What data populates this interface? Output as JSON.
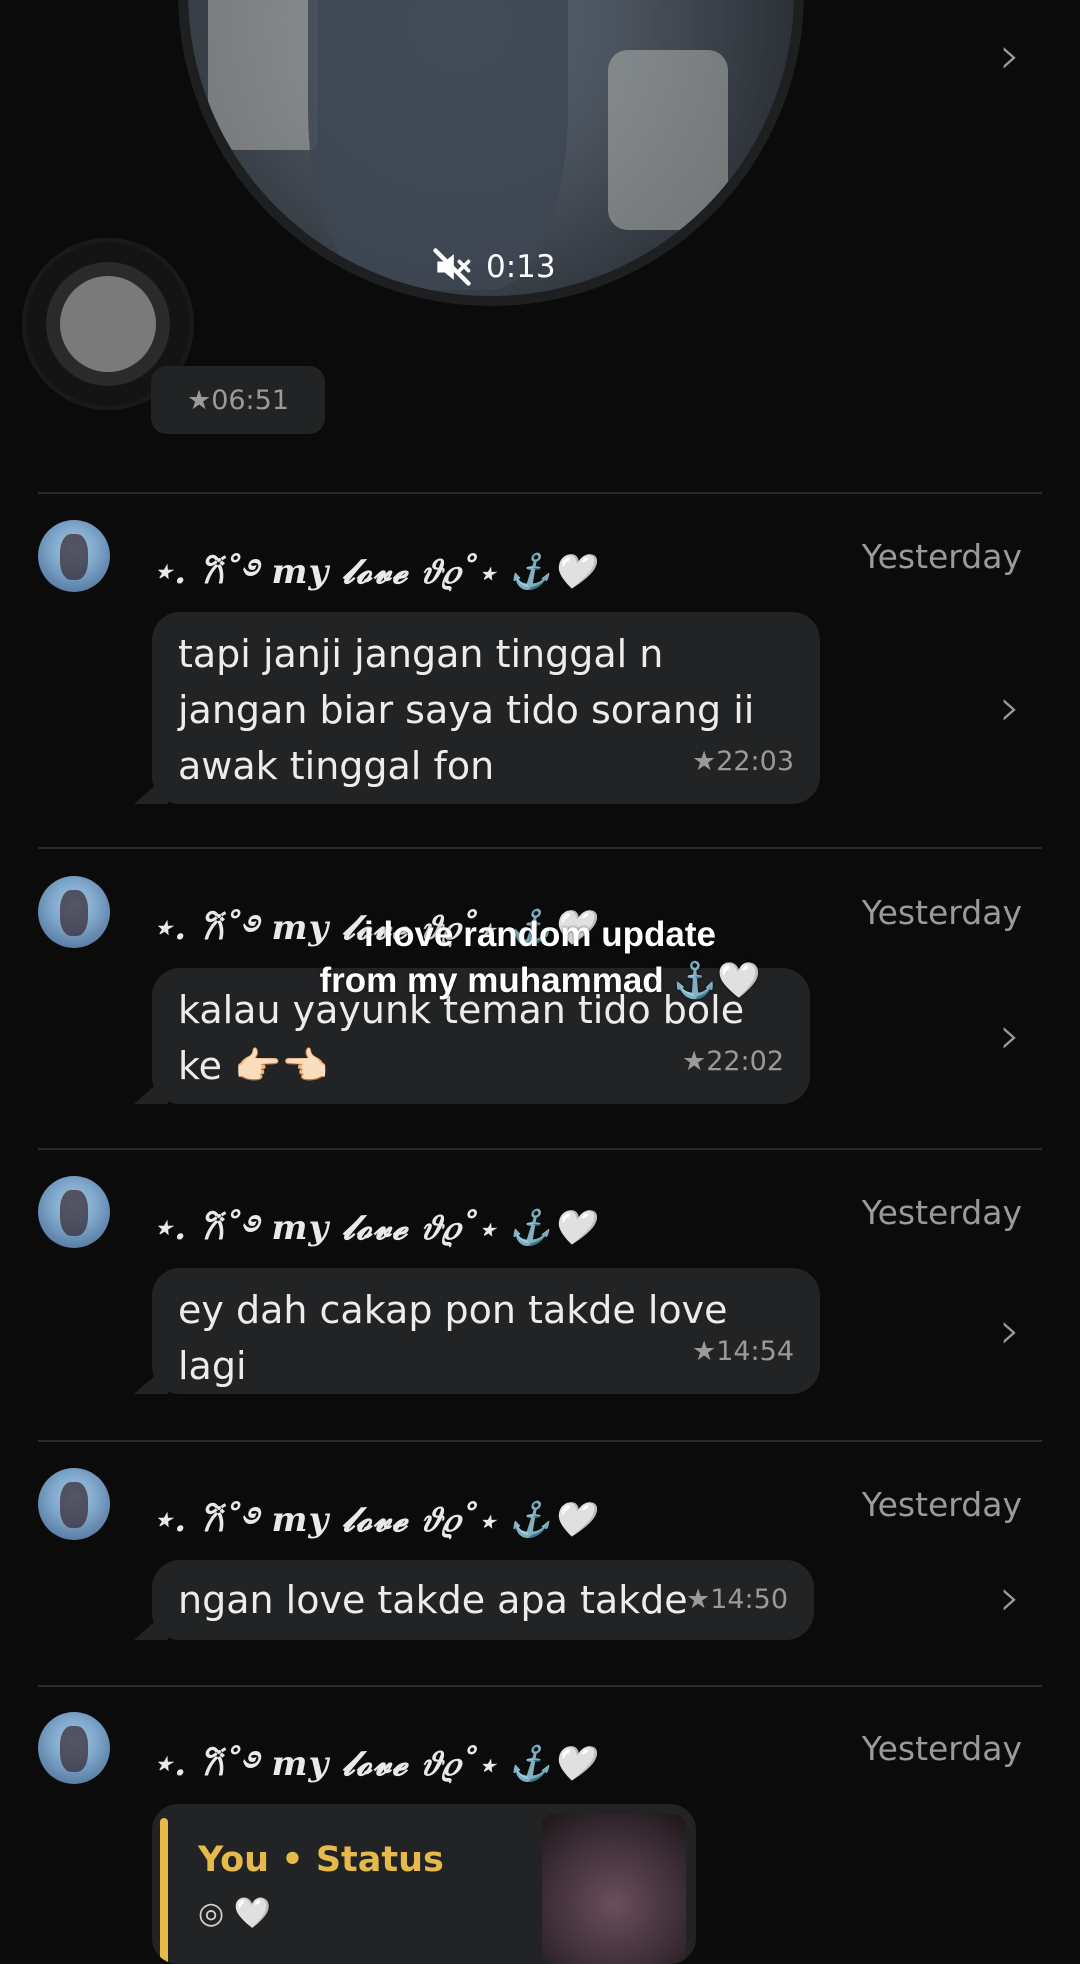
{
  "video_note": {
    "duration": "0:13",
    "icon": "mute-icon"
  },
  "record_button": {
    "icon": "record-icon"
  },
  "first_time": "★06:51",
  "overlay_caption": {
    "line1": "i love random update",
    "line2": "from my muhammad ⚓🤍"
  },
  "messages": [
    {
      "sender": "⋆. 𐙚˚࿔ 𝒎𝒚 𝓵𝓸𝓿𝓮 𝜗𝜚˚⋆ ⚓🤍",
      "date": "Yesterday",
      "text": "tapi janji jangan tinggal n jangan biar saya tido sorang ii awak tinggal fon",
      "time": "★22:03"
    },
    {
      "sender": "⋆. 𐙚˚࿔ 𝒎𝒚 𝓵𝓸𝓿𝓮 𝜗𝜚˚⋆ ⚓🤍",
      "date": "Yesterday",
      "text": "kalau yayunk teman tido bole ke 👉🏻👈🏻",
      "time": "★22:02"
    },
    {
      "sender": "⋆. 𐙚˚࿔ 𝒎𝒚 𝓵𝓸𝓿𝓮 𝜗𝜚˚⋆ ⚓🤍",
      "date": "Yesterday",
      "text": "ey dah cakap pon takde love lagi",
      "time": "★14:54"
    },
    {
      "sender": "⋆. 𐙚˚࿔ 𝒎𝒚 𝓵𝓸𝓿𝓮 𝜗𝜚˚⋆ ⚓🤍",
      "date": "Yesterday",
      "text": "ngan love takde apa takde",
      "time": "★14:50"
    },
    {
      "sender": "⋆. 𐙚˚࿔ 𝒎𝒚 𝓵𝓸𝓿𝓮 𝜗𝜚˚⋆ ⚓🤍",
      "date": "Yesterday"
    }
  ],
  "status_card": {
    "label": "You • Status",
    "sub": "◎ 🤍"
  },
  "colors": {
    "background": "#0b0b0b",
    "bubble": "#222324",
    "accent": "#e5b94a",
    "muted": "#9a9a9a"
  }
}
